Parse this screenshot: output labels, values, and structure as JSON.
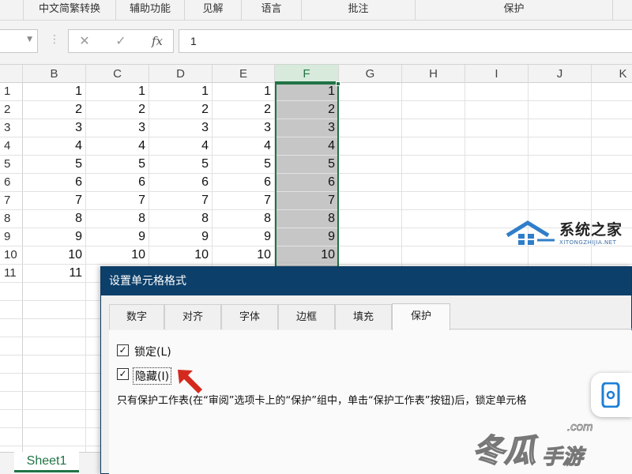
{
  "ribbon": {
    "groups": [
      "中文简繁转换",
      "辅助功能",
      "见解",
      "语言",
      "批注",
      "保护"
    ]
  },
  "formula_bar": {
    "cancel_icon": "close-icon",
    "enter_icon": "check-icon",
    "function_label": "fx",
    "value": "1"
  },
  "grid": {
    "columns": [
      "B",
      "C",
      "D",
      "E",
      "F",
      "G",
      "H",
      "I",
      "J",
      "K"
    ],
    "selected_column": "F",
    "rows": [
      {
        "n": "1",
        "b": "1",
        "c": "1",
        "d": "1",
        "e": "1",
        "f": "1"
      },
      {
        "n": "2",
        "b": "2",
        "c": "2",
        "d": "2",
        "e": "2",
        "f": "2"
      },
      {
        "n": "3",
        "b": "3",
        "c": "3",
        "d": "3",
        "e": "3",
        "f": "3"
      },
      {
        "n": "4",
        "b": "4",
        "c": "4",
        "d": "4",
        "e": "4",
        "f": "4"
      },
      {
        "n": "5",
        "b": "5",
        "c": "5",
        "d": "5",
        "e": "5",
        "f": "5"
      },
      {
        "n": "6",
        "b": "6",
        "c": "6",
        "d": "6",
        "e": "6",
        "f": "6"
      },
      {
        "n": "7",
        "b": "7",
        "c": "7",
        "d": "7",
        "e": "7",
        "f": "7"
      },
      {
        "n": "8",
        "b": "8",
        "c": "8",
        "d": "8",
        "e": "8",
        "f": "8"
      },
      {
        "n": "9",
        "b": "9",
        "c": "9",
        "d": "9",
        "e": "9",
        "f": "9"
      },
      {
        "n": "10",
        "b": "10",
        "c": "10",
        "d": "10",
        "e": "10",
        "f": "10"
      },
      {
        "n": "11",
        "b": "11",
        "c": "",
        "d": "",
        "e": "",
        "f": ""
      }
    ]
  },
  "sheet_tab": "Sheet1",
  "dialog": {
    "title": "设置单元格格式",
    "tabs": [
      "数字",
      "对齐",
      "字体",
      "边框",
      "填充",
      "保护"
    ],
    "active_tab": "保护",
    "locked_label": "锁定(L)",
    "locked_checked": true,
    "hidden_label": "隐藏(I)",
    "hidden_checked": true,
    "check_mark": "✓",
    "note": "只有保护工作表(在“审阅”选项卡上的“保护”组中，单击“保护工作表”按钮)后，锁定单元格"
  },
  "watermarks": {
    "site_name": "系统之家",
    "site_url": "XITONGZHIJIA.NET",
    "game_site_main": "冬瓜",
    "game_site_suffix": "手游",
    "game_site_com": ".com"
  },
  "colors": {
    "accent": "#217346",
    "dialog_title_bg": "#0c3f6a",
    "selected_cells": "#c6c6c6",
    "arrow": "#d42a1e"
  }
}
